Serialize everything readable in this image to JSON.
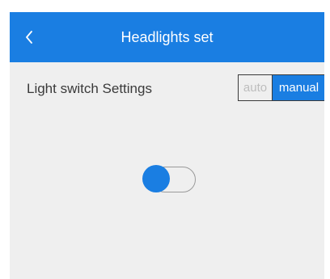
{
  "header": {
    "title": "Headlights set",
    "back_icon": "chevron-left-icon"
  },
  "setting": {
    "label": "Light switch Settings",
    "options": [
      "auto",
      "manual"
    ],
    "selected": "manual"
  },
  "toggle": {
    "state": "on"
  },
  "colors": {
    "accent": "#1a7ee2",
    "background": "#efefef",
    "text": "#3a3a3a",
    "inactive_text": "#bdbdbd"
  }
}
